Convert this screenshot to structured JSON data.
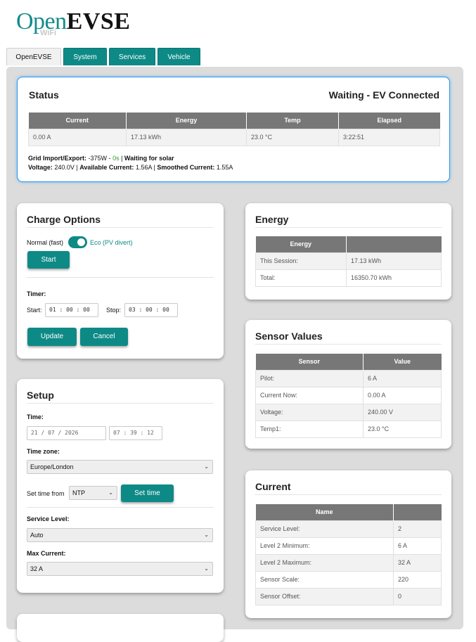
{
  "logo": {
    "open": "Open",
    "evse": "EVSE",
    "wifi": "WiFi"
  },
  "tabs": [
    {
      "label": "OpenEVSE",
      "active": true
    },
    {
      "label": "System",
      "active": false
    },
    {
      "label": "Services",
      "active": false
    },
    {
      "label": "Vehicle",
      "active": false
    }
  ],
  "status": {
    "title": "Status",
    "state": "Waiting - EV Connected",
    "headers": [
      "Current",
      "Energy",
      "Temp",
      "Elapsed"
    ],
    "values": [
      "0.00 A",
      "17.13 kWh",
      "23.0 °C",
      "3:22:51"
    ],
    "grid_label": "Grid Import/Export:",
    "grid_value": "-375W",
    "grid_sep": "-",
    "grid_time": "0s",
    "grid_state": "Waiting for solar",
    "voltage_label": "Voltage:",
    "voltage_value": "240.0V",
    "available_label": "Available Current:",
    "available_value": "1.56A",
    "smoothed_label": "Smoothed Current:",
    "smoothed_value": "1.55A"
  },
  "charge_options": {
    "title": "Charge Options",
    "normal_label": "Normal (fast)",
    "eco_label": "Eco (PV divert)",
    "start_button": "Start",
    "timer_label": "Timer:",
    "start_label": "Start:",
    "start_value": "01 : 00 : 00",
    "stop_label": "Stop:",
    "stop_value": "03 : 00 : 00",
    "update_button": "Update",
    "cancel_button": "Cancel"
  },
  "energy": {
    "title": "Energy",
    "headers": [
      "Energy",
      ""
    ],
    "rows": [
      [
        "This Session:",
        "17.13 kWh"
      ],
      [
        "Total:",
        "16350.70 kWh"
      ]
    ]
  },
  "sensor_values": {
    "title": "Sensor Values",
    "headers": [
      "Sensor",
      "Value"
    ],
    "rows": [
      [
        "Pilot:",
        "6 A"
      ],
      [
        "Current Now:",
        "0.00 A"
      ],
      [
        "Voltage:",
        "240.00 V"
      ],
      [
        "Temp1:",
        "23.0 °C"
      ]
    ]
  },
  "setup": {
    "title": "Setup",
    "time_label": "Time:",
    "date_value": "21 / 07 / 2026",
    "time_value": "07 : 39 : 12",
    "timezone_label": "Time zone:",
    "timezone_value": "Europe/London",
    "set_time_from_label": "Set time from",
    "set_time_from_value": "NTP",
    "set_time_button": "Set time",
    "service_level_label": "Service Level:",
    "service_level_value": "Auto",
    "max_current_label": "Max Current:",
    "max_current_value": "32 A"
  },
  "current": {
    "title": "Current",
    "headers": [
      "Name",
      ""
    ],
    "rows": [
      [
        "Service Level:",
        "2"
      ],
      [
        "Level 2 Minimum:",
        "6 A"
      ],
      [
        "Level 2 Maximum:",
        "32 A"
      ],
      [
        "Sensor Scale:",
        "220"
      ],
      [
        "Sensor Offset:",
        "0"
      ]
    ]
  },
  "colors": {
    "accent": "#0e8a86",
    "status_border": "#2196f3",
    "table_header": "#777777",
    "eco_green": "#2e9a2e"
  }
}
